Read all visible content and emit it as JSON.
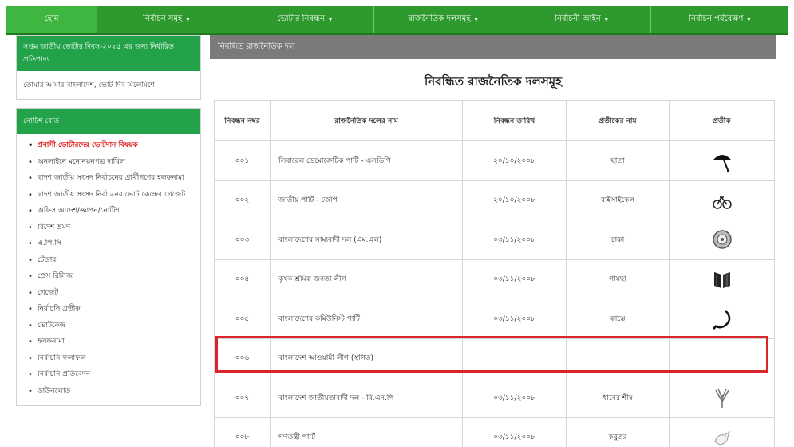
{
  "nav": [
    {
      "label": "হোম",
      "has_dropdown": false
    },
    {
      "label": "নির্বাচন সমূহ",
      "has_dropdown": true
    },
    {
      "label": "ভোটার নিবন্ধন",
      "has_dropdown": true
    },
    {
      "label": "রাজনৈতিক দলসমূহ",
      "has_dropdown": true
    },
    {
      "label": "নির্বাচনী আইন",
      "has_dropdown": true
    },
    {
      "label": "নির্বাচন পর্যবেক্ষণ",
      "has_dropdown": true
    }
  ],
  "caret": "▾",
  "sidebar": {
    "campaign": {
      "heading": "সপ্তম জাতীয় ভোটার দিবস-২০২৫ এর জন্য নির্ধারিত প্রতিপাদ্য",
      "text": "তোমার আমার বাংলাদেশ, ভোট দিব মিলেমিশে"
    },
    "notice": {
      "heading": "নোটিশ বোর্ড",
      "items": [
        {
          "label": "প্রবাসী ভোটারদের ভোটদান বিষয়ক",
          "highlight": true
        },
        {
          "label": "অনলাইনে মনোনয়নপত্র দাখিল",
          "highlight": false
        },
        {
          "label": "দ্বাদশ জাতীয় সংসদ নির্বাচনের প্রার্থীগণের হলফনামা",
          "highlight": false
        },
        {
          "label": "দ্বাদশ জাতীয় সংসদ নির্বাচনের ভোট কেন্দ্রের গেজেট",
          "highlight": false
        },
        {
          "label": "অফিস আদেশ/জ্ঞাপন/নোটিশ",
          "highlight": false
        },
        {
          "label": "বিদেশ ভ্রমণ",
          "highlight": false
        },
        {
          "label": "এ.পি.সি",
          "highlight": false
        },
        {
          "label": "টেন্ডার",
          "highlight": false
        },
        {
          "label": "প্রেস রিলিজ",
          "highlight": false
        },
        {
          "label": "গেজেট",
          "highlight": false
        },
        {
          "label": "নির্বাচনি প্রতীক",
          "highlight": false
        },
        {
          "label": "ভোটকেন্দ্র",
          "highlight": false
        },
        {
          "label": "হলফনামা",
          "highlight": false
        },
        {
          "label": "নির্বাচনি ফলাফল",
          "highlight": false
        },
        {
          "label": "নির্বাচনি প্রতিবেদন",
          "highlight": false
        },
        {
          "label": "ডাউনলোড",
          "highlight": false
        }
      ]
    }
  },
  "main": {
    "section_title": "নিবন্ধিত রাজনৈতিক দল",
    "page_title": "নিবন্ধিত রাজনৈতিক দলসমূহ",
    "columns": [
      "নিবন্ধন নম্বর",
      "রাজনৈতিক দলের নাম",
      "নিবন্ধন তারিখ",
      "প্রতীকের নাম",
      "প্রতীক"
    ],
    "rows": [
      {
        "no": "০০১",
        "name": "লিবারেল ডেমোক্রেটিক পার্টি - এলডিপি",
        "date": "২০/১০/২০০৮",
        "symbol_name": "ছাতা",
        "symbol_icon": "umbrella-icon",
        "highlighted": false
      },
      {
        "no": "০০২",
        "name": "জাতীয় পার্টি - জেপি",
        "date": "২০/১০/২০০৮",
        "symbol_name": "বাইসাইকেল",
        "symbol_icon": "bicycle-icon",
        "highlighted": false
      },
      {
        "no": "০০৩",
        "name": "বাংলাদেশের সাম্যবাদী দল (এম.এল)",
        "date": "০৩/১১/২০০৮",
        "symbol_name": "চাকা",
        "symbol_icon": "wheel-icon",
        "highlighted": false
      },
      {
        "no": "০০৪",
        "name": "কৃষক শ্রমিক জনতা লীগ",
        "date": "০৩/১১/২০০৮",
        "symbol_name": "গামছা",
        "symbol_icon": "gamchha-icon",
        "highlighted": false
      },
      {
        "no": "০০৫",
        "name": "বাংলাদেশের কমিউনিস্ট পার্টি",
        "date": "০৩/১১/২০০৮",
        "symbol_name": "কাস্তে",
        "symbol_icon": "sickle-icon",
        "highlighted": false
      },
      {
        "no": "০০৬",
        "name": "বাংলাদেশ আওয়ামী লীগ (স্থগিত)",
        "date": "",
        "symbol_name": "",
        "symbol_icon": "",
        "highlighted": true
      },
      {
        "no": "০০৭",
        "name": "বাংলাদেশ জাতীয়তাবাদী দল - বি.এন.পি",
        "date": "০৩/১১/২০০৮",
        "symbol_name": "ধানের শীষ",
        "symbol_icon": "paddy-sheaf-icon",
        "highlighted": false
      },
      {
        "no": "০০৮",
        "name": "গণতন্ত্রী পার্টি",
        "date": "০৩/১১/২০০৮",
        "symbol_name": "কবুতর",
        "symbol_icon": "pigeon-icon",
        "highlighted": false
      }
    ],
    "highlight_color": "#d9262a"
  },
  "colors": {
    "nav_green": "#2e9a2e",
    "sidebar_green": "#22a34a",
    "notice_red": "#e01b1b",
    "section_grey": "#7a7a7a"
  }
}
